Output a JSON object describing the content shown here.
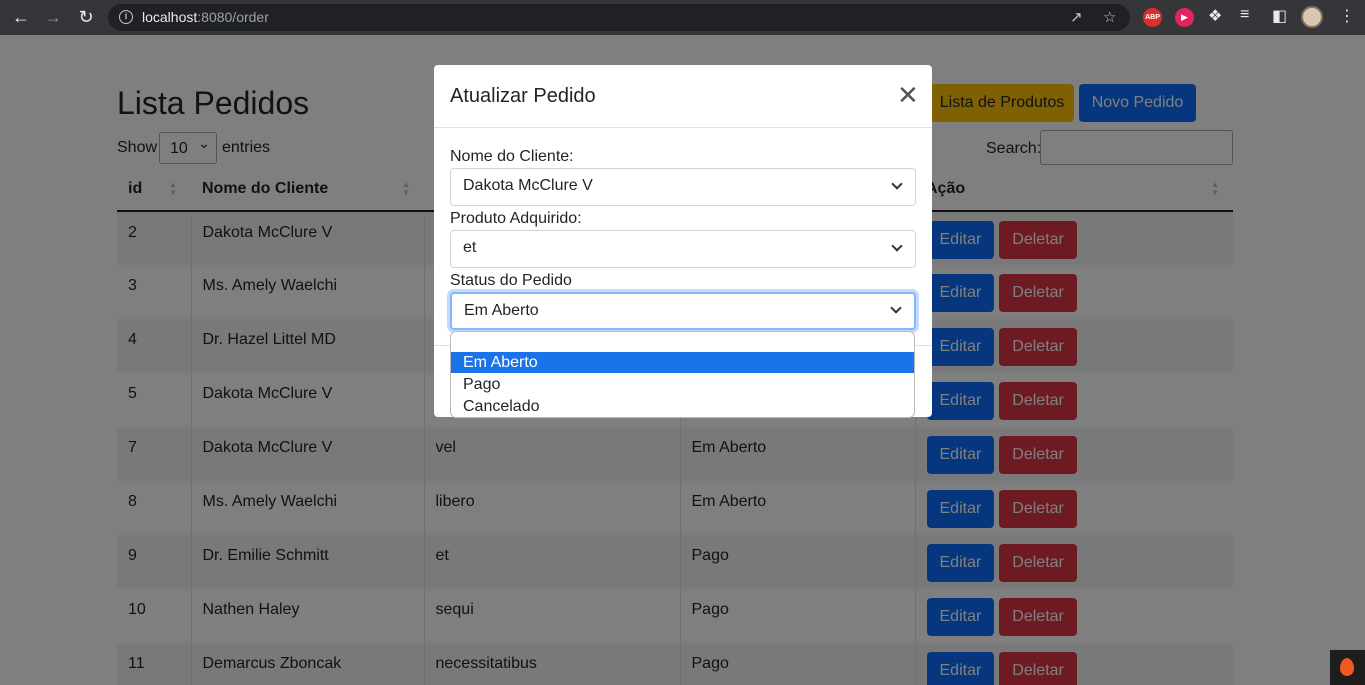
{
  "browser": {
    "url_host": "localhost",
    "url_rest": ":8080/order",
    "ext_abp": "ABP"
  },
  "page": {
    "title": "Lista Pedidos",
    "products_button": "Lista de Produtos",
    "new_order_button": "Novo Pedido",
    "show_label": "Show",
    "entries_value": "10",
    "entries_label": "entries",
    "search_label": "Search:"
  },
  "table": {
    "headers": [
      "id",
      "Nome do Cliente",
      "",
      "",
      "Ação"
    ],
    "rows": [
      {
        "id": "2",
        "cliente": "Dakota McClure V",
        "produto": "",
        "status": ""
      },
      {
        "id": "3",
        "cliente": "Ms. Amely Waelchi",
        "produto": "",
        "status": ""
      },
      {
        "id": "4",
        "cliente": "Dr. Hazel Littel MD",
        "produto": "",
        "status": ""
      },
      {
        "id": "5",
        "cliente": "Dakota McClure V",
        "produto": "",
        "status": ""
      },
      {
        "id": "7",
        "cliente": "Dakota McClure V",
        "produto": "vel",
        "status": "Em Aberto"
      },
      {
        "id": "8",
        "cliente": "Ms. Amely Waelchi",
        "produto": "libero",
        "status": "Em Aberto"
      },
      {
        "id": "9",
        "cliente": "Dr. Emilie Schmitt",
        "produto": "et",
        "status": "Pago"
      },
      {
        "id": "10",
        "cliente": "Nathen Haley",
        "produto": "sequi",
        "status": "Pago"
      },
      {
        "id": "11",
        "cliente": "Demarcus Zboncak",
        "produto": "necessitatibus",
        "status": "Pago"
      }
    ],
    "edit_label": "Editar",
    "delete_label": "Deletar"
  },
  "modal": {
    "title": "Atualizar Pedido",
    "client_label": "Nome do Cliente:",
    "client_value": "Dakota McClure V",
    "product_label": "Produto Adquirido:",
    "product_value": "et",
    "status_label": "Status do Pedido",
    "status_value": "Em Aberto",
    "status_options": [
      "Em Aberto",
      "Pago",
      "Cancelado"
    ]
  },
  "colors": {
    "primary": "#0d6efd",
    "warning": "#ffc107",
    "danger": "#dc3545",
    "dropdown_highlight": "#1a73e8"
  }
}
